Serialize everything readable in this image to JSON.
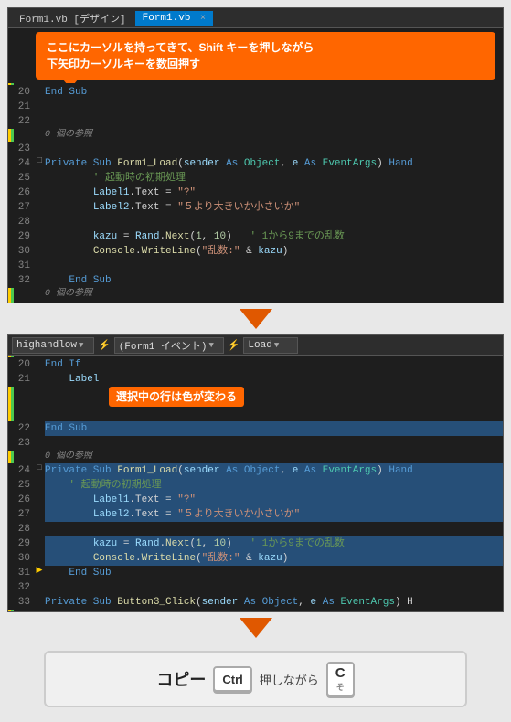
{
  "topBlock": {
    "titleTabs": [
      {
        "label": "Form1.vb [デザイン]",
        "active": false
      },
      {
        "label": "Form1.vb",
        "active": true
      },
      {
        "close": "×"
      }
    ],
    "callout": {
      "line1": "ここにカーソルを持ってきて、Shift キーを押しながら",
      "line2": "下矢印カーソルキーを数回押す"
    },
    "lines": [
      {
        "num": "20",
        "indent": "",
        "content": "End Sub"
      },
      {
        "num": "21",
        "indent": ""
      },
      {
        "num": "22",
        "indent": ""
      },
      {
        "num": "23",
        "indent": ""
      },
      {
        "num": "24",
        "indent": "",
        "content": "Private Sub Form1_Load(sender As Object, e As EventArgs) Hand"
      },
      {
        "num": "25",
        "indent": "        ",
        "content": "' 起動時の初期処理"
      },
      {
        "num": "26",
        "indent": "        ",
        "content": "Label1.Text = \"?\""
      },
      {
        "num": "27",
        "indent": "        ",
        "content": "Label2.Text = \"５より大きいか小さいか\""
      },
      {
        "num": "28",
        "indent": ""
      },
      {
        "num": "29",
        "indent": "        ",
        "content": "kazu = Rand.Next(1, 10)   ' 1から9までの乱数"
      },
      {
        "num": "30",
        "indent": "        ",
        "content": "Console.WriteLine(\"乱数:\" & kazu)"
      },
      {
        "num": "31",
        "indent": ""
      },
      {
        "num": "32",
        "indent": "    ",
        "content": "End Sub"
      }
    ],
    "ref0": "0 個の参照",
    "ref1": "0 個の参照"
  },
  "bottomBlock": {
    "dropdowns": [
      {
        "label": "highandlow"
      },
      {
        "label": "(Form1 イベント)"
      },
      {
        "label": "Load"
      }
    ],
    "inlineCallout": "選択中の行は色が変わる",
    "lines": [
      {
        "num": "20",
        "content": "End If"
      },
      {
        "num": "21",
        "content": "Label"
      },
      {
        "num": "22",
        "content": "End Sub",
        "selected": true
      },
      {
        "num": "23",
        "content": "",
        "selected": true
      },
      {
        "num": "24",
        "content": "Private Sub Form1_Load(sender As Object, e As EventArgs) Hand",
        "selected": true
      },
      {
        "num": "25",
        "content": "    ' 起動時の初期処理",
        "selected": true
      },
      {
        "num": "26",
        "content": "    Label1.Text = \"?\"",
        "selected": true
      },
      {
        "num": "27",
        "content": "    Label2.Text = \"５より大きいか小さいか\"",
        "selected": true
      },
      {
        "num": "28",
        "content": "",
        "selected": true
      },
      {
        "num": "29",
        "content": "    kazu = Rand.Next(1, 10)   ' 1から9までの乱数",
        "selected": true
      },
      {
        "num": "30",
        "content": "    Console.WriteLine(\"乱数:\" & kazu)",
        "selected": true
      },
      {
        "num": "31",
        "content": "End Sub"
      },
      {
        "num": "32",
        "content": ""
      },
      {
        "num": "33",
        "content": "Private Sub Button3_Click(sender As Object, e As EventArgs) H"
      }
    ],
    "ref0": "0 個の参照"
  },
  "shortcut": {
    "label": "コピー",
    "key1": "Ctrl",
    "key2": "C",
    "key2sub": "そ",
    "text": "押しながら"
  }
}
